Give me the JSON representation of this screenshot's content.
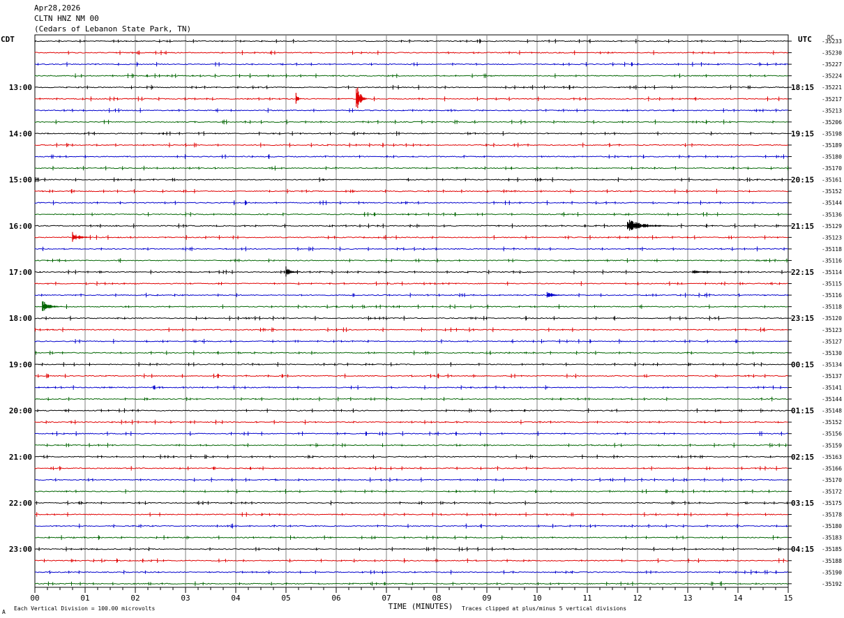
{
  "header": {
    "date": "Apr28,2026",
    "station": "CLTN HNZ NM 00",
    "location": "(Cedars of Lebanon State Park, TN)"
  },
  "left_zone_label": "CDT",
  "right_zone_label": "UTC",
  "dc_label": "DC",
  "footer": {
    "scale_note": "Each Vertical Division =  100.00 microvolts",
    "clip_note": "Traces clipped at plus/minus 5 vertical divisions",
    "corner_mark": "A"
  },
  "chart_data": {
    "type": "line",
    "subtype": "helicorder",
    "xlabel": "TIME (MINUTES)",
    "x_ticks": [
      "00",
      "01",
      "02",
      "03",
      "04",
      "05",
      "06",
      "07",
      "08",
      "09",
      "10",
      "11",
      "12",
      "13",
      "14",
      "15"
    ],
    "xlim": [
      0,
      15
    ],
    "trace_colors": [
      "#000000",
      "#e00000",
      "#0000cc",
      "#006400"
    ],
    "hour_labels_left": [
      "13:00",
      "14:00",
      "15:00",
      "16:00",
      "17:00",
      "18:00",
      "19:00",
      "20:00",
      "21:00",
      "22:00",
      "23:00"
    ],
    "hour_labels_right": [
      "18:15",
      "19:15",
      "20:15",
      "21:15",
      "22:15",
      "23:15",
      "00:15",
      "01:15",
      "02:15",
      "03:15",
      "04:15"
    ],
    "first_hour_label_row": 4,
    "dc_offsets": [
      "-35233",
      "-35230",
      "-35227",
      "-35224",
      "-35221",
      "-35217",
      "-35213",
      "-35206",
      "-35198",
      "-35189",
      "-35180",
      "-35170",
      "-35161",
      "-35152",
      "-35144",
      "-35136",
      "-35129",
      "-35123",
      "-35118",
      "-35116",
      "-35114",
      "-35115",
      "-35116",
      "-35118",
      "-35120",
      "-35123",
      "-35127",
      "-35130",
      "-35134",
      "-35137",
      "-35141",
      "-35144",
      "-35148",
      "-35152",
      "-35156",
      "-35159",
      "-35163",
      "-35166",
      "-35170",
      "-35172",
      "-35175",
      "-35178",
      "-35180",
      "-35183",
      "-35185",
      "-35188",
      "-35190",
      "-35192"
    ],
    "events": [
      {
        "row": 5,
        "minute": 5.2,
        "amplitude": 0.6,
        "duration_min": 0.1
      },
      {
        "row": 5,
        "minute": 6.4,
        "amplitude": 1.6,
        "duration_min": 0.2
      },
      {
        "row": 16,
        "minute": 11.8,
        "amplitude": 0.6,
        "duration_min": 0.9
      },
      {
        "row": 17,
        "minute": 0.75,
        "amplitude": 0.5,
        "duration_min": 0.4
      },
      {
        "row": 20,
        "minute": 5.0,
        "amplitude": 0.5,
        "duration_min": 0.3
      },
      {
        "row": 20,
        "minute": 13.1,
        "amplitude": 0.2,
        "duration_min": 0.8
      },
      {
        "row": 22,
        "minute": 10.2,
        "amplitude": 0.3,
        "duration_min": 0.4
      },
      {
        "row": 23,
        "minute": 0.15,
        "amplitude": 0.6,
        "duration_min": 0.4
      }
    ]
  }
}
